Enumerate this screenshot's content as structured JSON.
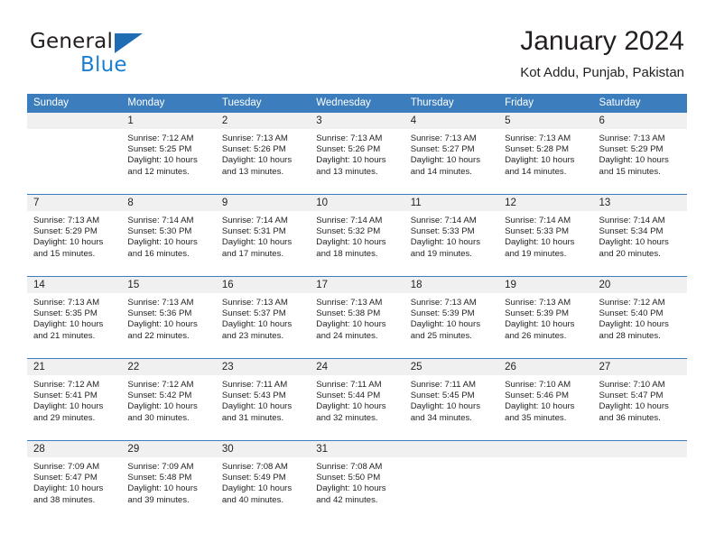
{
  "brand": {
    "name_part1": "General",
    "name_part2": "Blue",
    "logo_icon": "triangle-logo"
  },
  "header": {
    "title": "January 2024",
    "subtitle": "Kot Addu, Punjab, Pakistan"
  },
  "calendar": {
    "weekdays": [
      "Sunday",
      "Monday",
      "Tuesday",
      "Wednesday",
      "Thursday",
      "Friday",
      "Saturday"
    ],
    "accent_color": "#3c7ebd",
    "numband_color": "#f0f0f0",
    "weeks": [
      [
        {
          "day": "",
          "sunrise": "",
          "sunset": "",
          "daylight1": "",
          "daylight2": ""
        },
        {
          "day": "1",
          "sunrise": "Sunrise: 7:12 AM",
          "sunset": "Sunset: 5:25 PM",
          "daylight1": "Daylight: 10 hours",
          "daylight2": "and 12 minutes."
        },
        {
          "day": "2",
          "sunrise": "Sunrise: 7:13 AM",
          "sunset": "Sunset: 5:26 PM",
          "daylight1": "Daylight: 10 hours",
          "daylight2": "and 13 minutes."
        },
        {
          "day": "3",
          "sunrise": "Sunrise: 7:13 AM",
          "sunset": "Sunset: 5:26 PM",
          "daylight1": "Daylight: 10 hours",
          "daylight2": "and 13 minutes."
        },
        {
          "day": "4",
          "sunrise": "Sunrise: 7:13 AM",
          "sunset": "Sunset: 5:27 PM",
          "daylight1": "Daylight: 10 hours",
          "daylight2": "and 14 minutes."
        },
        {
          "day": "5",
          "sunrise": "Sunrise: 7:13 AM",
          "sunset": "Sunset: 5:28 PM",
          "daylight1": "Daylight: 10 hours",
          "daylight2": "and 14 minutes."
        },
        {
          "day": "6",
          "sunrise": "Sunrise: 7:13 AM",
          "sunset": "Sunset: 5:29 PM",
          "daylight1": "Daylight: 10 hours",
          "daylight2": "and 15 minutes."
        }
      ],
      [
        {
          "day": "7",
          "sunrise": "Sunrise: 7:13 AM",
          "sunset": "Sunset: 5:29 PM",
          "daylight1": "Daylight: 10 hours",
          "daylight2": "and 15 minutes."
        },
        {
          "day": "8",
          "sunrise": "Sunrise: 7:14 AM",
          "sunset": "Sunset: 5:30 PM",
          "daylight1": "Daylight: 10 hours",
          "daylight2": "and 16 minutes."
        },
        {
          "day": "9",
          "sunrise": "Sunrise: 7:14 AM",
          "sunset": "Sunset: 5:31 PM",
          "daylight1": "Daylight: 10 hours",
          "daylight2": "and 17 minutes."
        },
        {
          "day": "10",
          "sunrise": "Sunrise: 7:14 AM",
          "sunset": "Sunset: 5:32 PM",
          "daylight1": "Daylight: 10 hours",
          "daylight2": "and 18 minutes."
        },
        {
          "day": "11",
          "sunrise": "Sunrise: 7:14 AM",
          "sunset": "Sunset: 5:33 PM",
          "daylight1": "Daylight: 10 hours",
          "daylight2": "and 19 minutes."
        },
        {
          "day": "12",
          "sunrise": "Sunrise: 7:14 AM",
          "sunset": "Sunset: 5:33 PM",
          "daylight1": "Daylight: 10 hours",
          "daylight2": "and 19 minutes."
        },
        {
          "day": "13",
          "sunrise": "Sunrise: 7:14 AM",
          "sunset": "Sunset: 5:34 PM",
          "daylight1": "Daylight: 10 hours",
          "daylight2": "and 20 minutes."
        }
      ],
      [
        {
          "day": "14",
          "sunrise": "Sunrise: 7:13 AM",
          "sunset": "Sunset: 5:35 PM",
          "daylight1": "Daylight: 10 hours",
          "daylight2": "and 21 minutes."
        },
        {
          "day": "15",
          "sunrise": "Sunrise: 7:13 AM",
          "sunset": "Sunset: 5:36 PM",
          "daylight1": "Daylight: 10 hours",
          "daylight2": "and 22 minutes."
        },
        {
          "day": "16",
          "sunrise": "Sunrise: 7:13 AM",
          "sunset": "Sunset: 5:37 PM",
          "daylight1": "Daylight: 10 hours",
          "daylight2": "and 23 minutes."
        },
        {
          "day": "17",
          "sunrise": "Sunrise: 7:13 AM",
          "sunset": "Sunset: 5:38 PM",
          "daylight1": "Daylight: 10 hours",
          "daylight2": "and 24 minutes."
        },
        {
          "day": "18",
          "sunrise": "Sunrise: 7:13 AM",
          "sunset": "Sunset: 5:39 PM",
          "daylight1": "Daylight: 10 hours",
          "daylight2": "and 25 minutes."
        },
        {
          "day": "19",
          "sunrise": "Sunrise: 7:13 AM",
          "sunset": "Sunset: 5:39 PM",
          "daylight1": "Daylight: 10 hours",
          "daylight2": "and 26 minutes."
        },
        {
          "day": "20",
          "sunrise": "Sunrise: 7:12 AM",
          "sunset": "Sunset: 5:40 PM",
          "daylight1": "Daylight: 10 hours",
          "daylight2": "and 28 minutes."
        }
      ],
      [
        {
          "day": "21",
          "sunrise": "Sunrise: 7:12 AM",
          "sunset": "Sunset: 5:41 PM",
          "daylight1": "Daylight: 10 hours",
          "daylight2": "and 29 minutes."
        },
        {
          "day": "22",
          "sunrise": "Sunrise: 7:12 AM",
          "sunset": "Sunset: 5:42 PM",
          "daylight1": "Daylight: 10 hours",
          "daylight2": "and 30 minutes."
        },
        {
          "day": "23",
          "sunrise": "Sunrise: 7:11 AM",
          "sunset": "Sunset: 5:43 PM",
          "daylight1": "Daylight: 10 hours",
          "daylight2": "and 31 minutes."
        },
        {
          "day": "24",
          "sunrise": "Sunrise: 7:11 AM",
          "sunset": "Sunset: 5:44 PM",
          "daylight1": "Daylight: 10 hours",
          "daylight2": "and 32 minutes."
        },
        {
          "day": "25",
          "sunrise": "Sunrise: 7:11 AM",
          "sunset": "Sunset: 5:45 PM",
          "daylight1": "Daylight: 10 hours",
          "daylight2": "and 34 minutes."
        },
        {
          "day": "26",
          "sunrise": "Sunrise: 7:10 AM",
          "sunset": "Sunset: 5:46 PM",
          "daylight1": "Daylight: 10 hours",
          "daylight2": "and 35 minutes."
        },
        {
          "day": "27",
          "sunrise": "Sunrise: 7:10 AM",
          "sunset": "Sunset: 5:47 PM",
          "daylight1": "Daylight: 10 hours",
          "daylight2": "and 36 minutes."
        }
      ],
      [
        {
          "day": "28",
          "sunrise": "Sunrise: 7:09 AM",
          "sunset": "Sunset: 5:47 PM",
          "daylight1": "Daylight: 10 hours",
          "daylight2": "and 38 minutes."
        },
        {
          "day": "29",
          "sunrise": "Sunrise: 7:09 AM",
          "sunset": "Sunset: 5:48 PM",
          "daylight1": "Daylight: 10 hours",
          "daylight2": "and 39 minutes."
        },
        {
          "day": "30",
          "sunrise": "Sunrise: 7:08 AM",
          "sunset": "Sunset: 5:49 PM",
          "daylight1": "Daylight: 10 hours",
          "daylight2": "and 40 minutes."
        },
        {
          "day": "31",
          "sunrise": "Sunrise: 7:08 AM",
          "sunset": "Sunset: 5:50 PM",
          "daylight1": "Daylight: 10 hours",
          "daylight2": "and 42 minutes."
        },
        {
          "day": "",
          "sunrise": "",
          "sunset": "",
          "daylight1": "",
          "daylight2": ""
        },
        {
          "day": "",
          "sunrise": "",
          "sunset": "",
          "daylight1": "",
          "daylight2": ""
        },
        {
          "day": "",
          "sunrise": "",
          "sunset": "",
          "daylight1": "",
          "daylight2": ""
        }
      ]
    ]
  }
}
